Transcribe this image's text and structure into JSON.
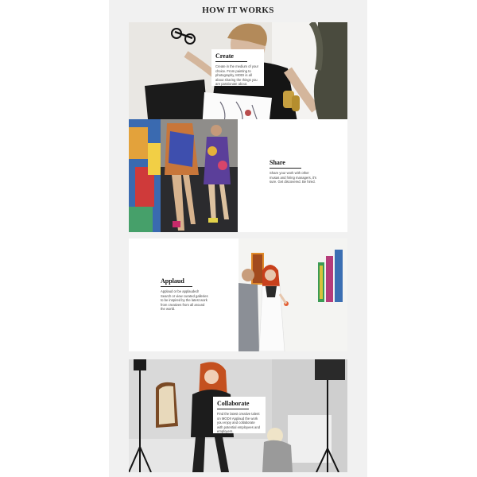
{
  "page": {
    "title": "HOW IT WORKS"
  },
  "steps": [
    {
      "title": "Create",
      "body": "Create in the medium of your choice. From painting to photography, MODI is all about sharing the things you are passionate about."
    },
    {
      "title": "Share",
      "body": "Share your work with other musas and hiring managers, it's sure. Get discovered. Be hired."
    },
    {
      "title": "Applaud",
      "body": "Applaud or be applauded! Search or view curated galleries to be inspired by the latest work from creatives from all around the world."
    },
    {
      "title": "Collaborate",
      "body": "Find the latest creative talent on MODI! Applaud the work you enjoy and collaborate with potential employees and employers."
    }
  ]
}
